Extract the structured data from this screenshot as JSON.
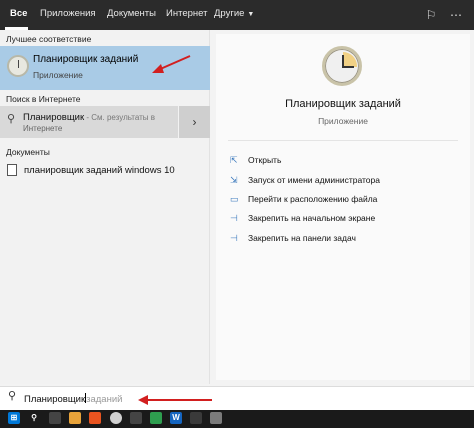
{
  "tabs": [
    {
      "label": "Все"
    },
    {
      "label": "Приложения"
    },
    {
      "label": "Документы"
    },
    {
      "label": "Интернет"
    },
    {
      "label": "Другие"
    }
  ],
  "sections": {
    "best_match": "Лучшее соответствие",
    "web": "Поиск в Интернете",
    "documents": "Документы"
  },
  "best_match": {
    "title": "Планировщик заданий",
    "subtitle": "Приложение"
  },
  "web_result": {
    "query": "Планировщик",
    "hint": " - См. результаты в",
    "hint2": "Интернете"
  },
  "document": {
    "label": "планировщик заданий windows 10"
  },
  "detail": {
    "title": "Планировщик заданий",
    "subtitle": "Приложение",
    "actions": [
      {
        "label": "Открыть"
      },
      {
        "label": "Запуск от имени администратора"
      },
      {
        "label": "Перейти к расположению файла"
      },
      {
        "label": "Закрепить на начальном экране"
      },
      {
        "label": "Закрепить на панели задач"
      }
    ]
  },
  "search": {
    "typed": "Планировщик",
    "suggestion": "заданий"
  },
  "colors": {
    "accent": "#a9cbe6",
    "arrow": "#d21f1f",
    "topbar": "#2b2b2b",
    "taskbar": "#1a1a1a"
  }
}
